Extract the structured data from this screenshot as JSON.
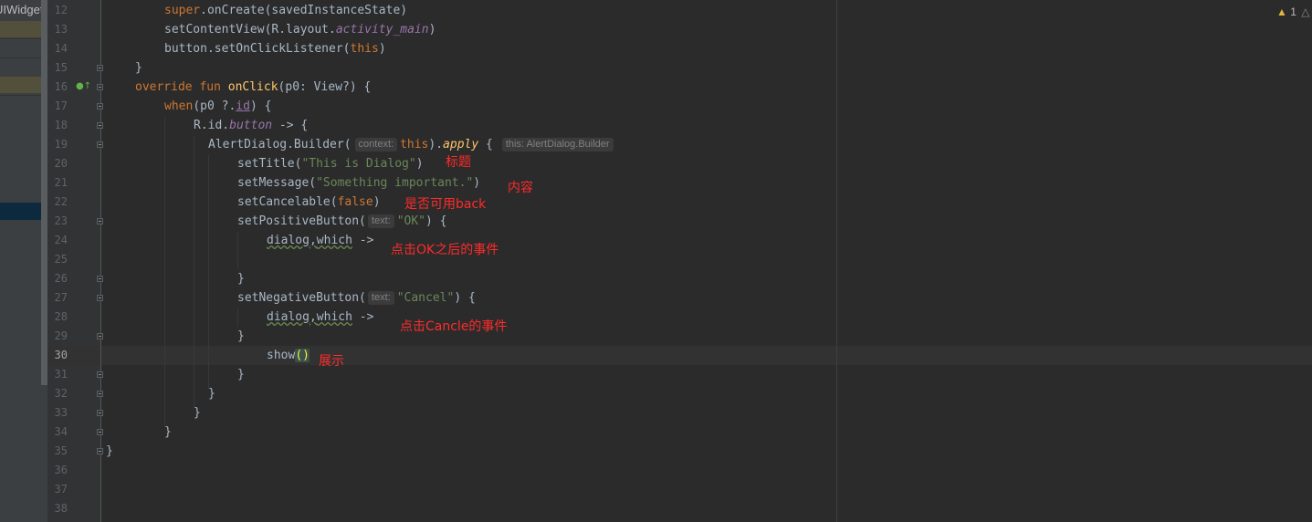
{
  "project_panel": {
    "label": "UIWidget"
  },
  "inspection": {
    "warning_count": "1",
    "warning_icon": "warning-triangle",
    "weak_icon": "weak-warning-triangle"
  },
  "line_numbers": [
    "12",
    "13",
    "14",
    "15",
    "16",
    "17",
    "18",
    "19",
    "20",
    "21",
    "22",
    "23",
    "24",
    "25",
    "26",
    "27",
    "28",
    "29",
    "30",
    "31",
    "32",
    "33",
    "34",
    "35",
    "36",
    "37",
    "38"
  ],
  "current_line": "30",
  "code": {
    "l12": {
      "t1": "super",
      "t2": ".onCreate(savedInstanceState)"
    },
    "l13": {
      "t1": "setContentView(R.layout.",
      "t2": "activity_main",
      "t3": ")"
    },
    "l14": {
      "t1": "button.setOnClickListener(",
      "t2": "this",
      "t3": ")"
    },
    "l15": {
      "t1": "}"
    },
    "l16": {
      "t1": "override fun ",
      "t2": "onClick",
      "t3": "(p0: View?) {"
    },
    "l17": {
      "t1": "when",
      "t2": "(p0 ?.",
      "t3": "id",
      "t4": ") {"
    },
    "l18": {
      "t1": "R.id.",
      "t2": "button",
      "t3": " -> {"
    },
    "l19": {
      "t1": "AlertDialog.Builder(",
      "hint1": "context:",
      "t2": "this",
      "t3": ").",
      "t4": "apply",
      "t5": " {",
      "hint2": "this: AlertDialog.Builder"
    },
    "l20": {
      "t1": "setTitle(",
      "t2": "\"This is Dialog\"",
      "t3": ")"
    },
    "l21": {
      "t1": "setMessage(",
      "t2": "\"Something important.\"",
      "t3": ")"
    },
    "l22": {
      "t1": "setCancelable(",
      "t2": "false",
      "t3": ")"
    },
    "l23": {
      "t1": "setPositiveButton(",
      "hint": "text:",
      "t2": "\"OK\"",
      "t3": ") {"
    },
    "l24": {
      "t1": "dialog",
      "t2": ",",
      "t3": "which",
      "t4": " ->"
    },
    "l26": {
      "t1": "}"
    },
    "l27": {
      "t1": "setNegativeButton(",
      "hint": "text:",
      "t2": "\"Cancel\"",
      "t3": ") {"
    },
    "l28": {
      "t1": "dialog",
      "t2": ",",
      "t3": "which",
      "t4": " ->"
    },
    "l29": {
      "t1": "}"
    },
    "l30": {
      "t1": "show",
      "t2": "()"
    },
    "l31": {
      "t1": "}"
    },
    "l32": {
      "t1": "}"
    },
    "l33": {
      "t1": "}"
    },
    "l34": {
      "t1": "}"
    },
    "l35": {
      "t1": "}"
    }
  },
  "annotations": {
    "title": "标题",
    "message": "内容",
    "cancelable": "是否可用back",
    "ok_event": "点击OK之后的事件",
    "cancel_event": "点击Cancle的事件",
    "show": "展示"
  },
  "colors": {
    "background": "#2b2b2b",
    "keyword": "#cc7832",
    "function": "#ffc66d",
    "string": "#6a8759",
    "property": "#9876aa",
    "annotation": "#ff2b2b"
  }
}
